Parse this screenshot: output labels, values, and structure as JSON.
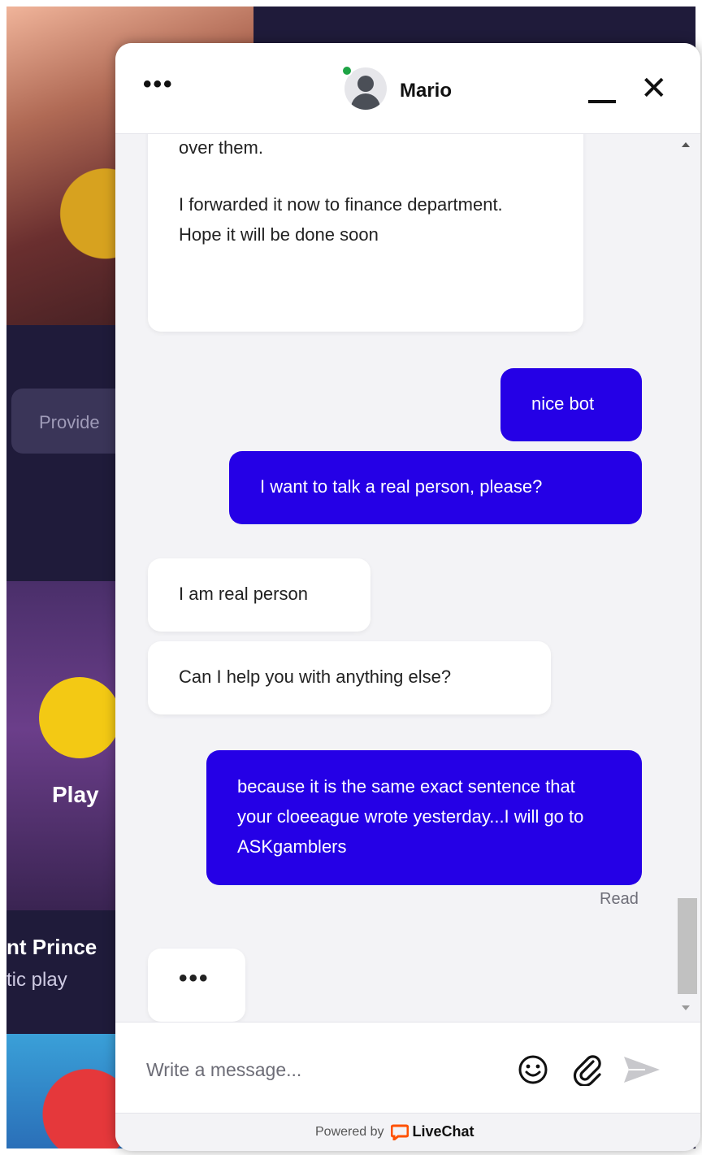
{
  "background": {
    "provider_label": "Provide",
    "play_label": "Play",
    "game_title": "nt Prince",
    "game_subtitle": "tic play"
  },
  "header": {
    "more_label": "•••",
    "agent_name": "Mario",
    "agent_status_color": "#1ea445",
    "close_label": "✕"
  },
  "messages": [
    {
      "from": "agent",
      "text": "over them."
    },
    {
      "from": "agent",
      "text": "I forwarded it now to finance department. Hope it will be done soon"
    },
    {
      "from": "visitor",
      "text": "nice bot"
    },
    {
      "from": "visitor",
      "text": "I want to talk a real person, please?"
    },
    {
      "from": "agent",
      "text": "I am real person"
    },
    {
      "from": "agent",
      "text": "Can I help you with anything else?"
    },
    {
      "from": "visitor",
      "text": "because it is the same exact sentence that your cloeeague wrote yesterday...I will go to ASKgamblers"
    }
  ],
  "read_status": "Read",
  "typing_indicator": "•••",
  "composer": {
    "placeholder": "Write a message..."
  },
  "footer": {
    "powered_label": "Powered by",
    "brand": "LiveChat"
  },
  "colors": {
    "visitor_bubble": "#2500e6",
    "agent_bubble": "#ffffff",
    "brand_orange": "#ff5100"
  }
}
